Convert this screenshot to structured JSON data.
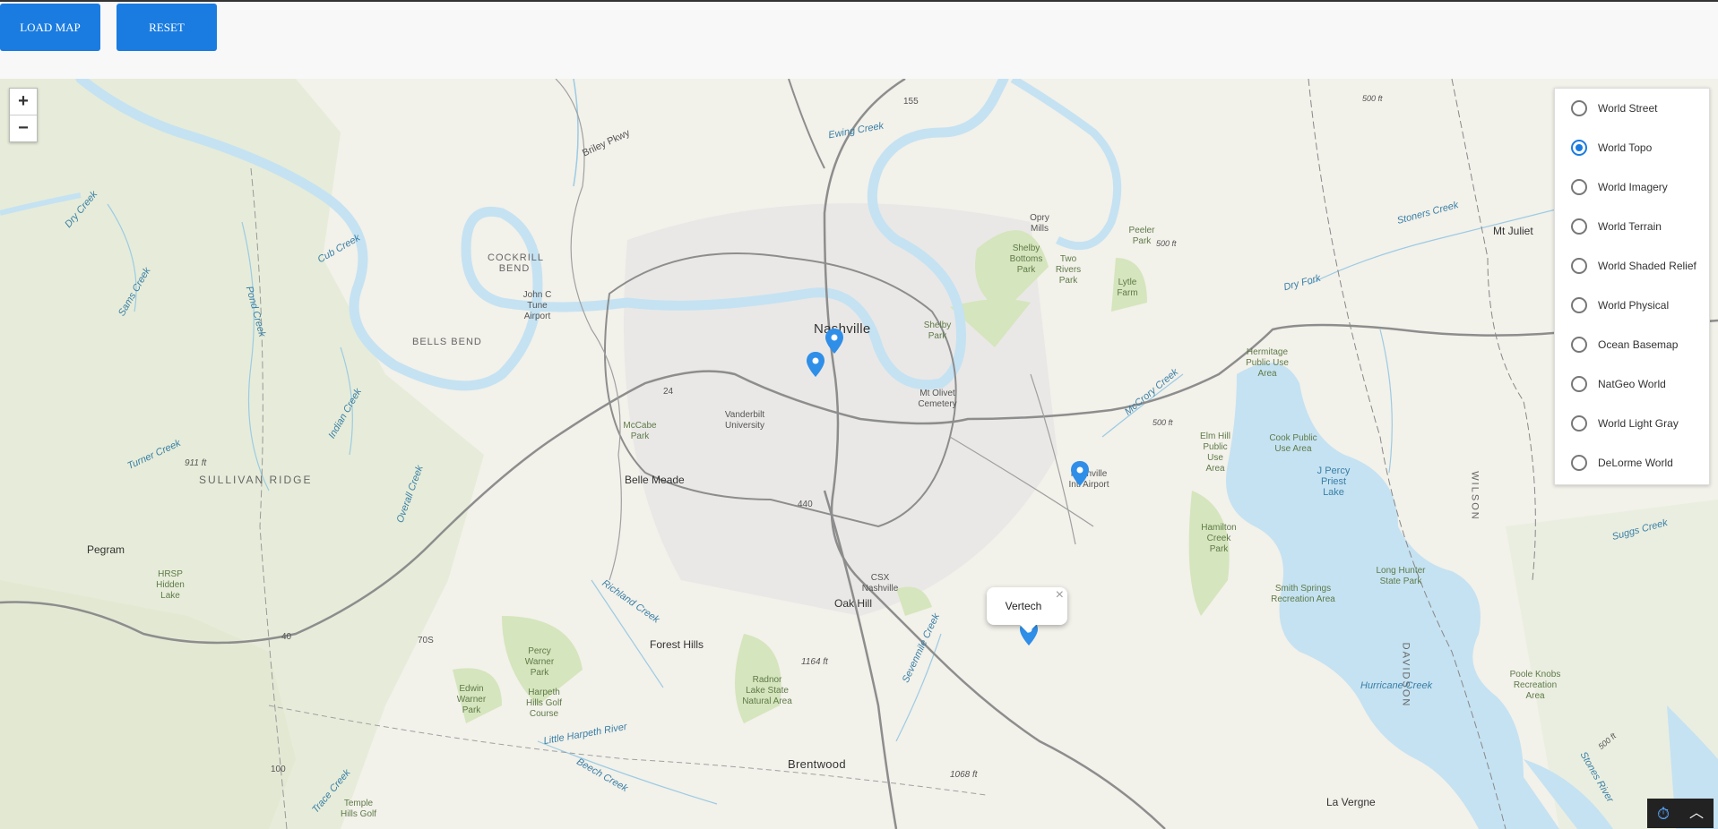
{
  "toolbar": {
    "load_label": "LOAD MAP",
    "reset_label": "RESET"
  },
  "zoom": {
    "in_label": "+",
    "out_label": "−"
  },
  "basemaps": {
    "options": [
      "World Street",
      "World Topo",
      "World Imagery",
      "World Terrain",
      "World Shaded Relief",
      "World Physical",
      "Ocean Basemap",
      "NatGeo World",
      "World Light Gray",
      "DeLorme World"
    ],
    "selected": "World Topo"
  },
  "popup": {
    "title": "Vertech",
    "close_label": "×"
  },
  "map_labels": {
    "nashville": "Nashville",
    "belle_meade": "Belle Meade",
    "oak_hill": "Oak Hill",
    "forest_hills": "Forest Hills",
    "brentwood": "Brentwood",
    "la_vergne": "La Vergne",
    "pegram": "Pegram",
    "mt_juliet": "Mt Juliet",
    "bells_bend": "BELLS BEND",
    "cockrill_bend": "COCKRILL BEND",
    "sullivan_ridge": "SULLIVAN RIDGE",
    "davidson": "DAVIDSON",
    "wilson": "WILSON",
    "john_tune": "John C Tune Airport",
    "intl_airport": "Nashville Intl Airport",
    "vanderbilt": "Vanderbilt University",
    "mccabe": "McCabe Park",
    "shelby_park": "Shelby Park",
    "shelby_bottoms": "Shelby Bottoms Park",
    "two_rivers": "Two Rivers Park",
    "opry_mills": "Opry Mills",
    "mt_olivet": "Mt Olivet Cemetery",
    "csx": "CSX Nashville",
    "percy_warner": "Percy Warner Park",
    "edwin_warner": "Edwin Warner Park",
    "harpeth_hills": "Harpeth Hills Golf Course",
    "radnor": "Radnor Lake State Natural Area",
    "hrsp": "HRSP Hidden Lake",
    "temple_hills": "Temple Hills Golf",
    "peeler": "Peeler Park",
    "lytle": "Lytle Farm",
    "hermitage": "Hermitage Public Use Area",
    "elm_hill": "Elm Hill Public Use Area",
    "cook_public": "Cook Public Use Area",
    "j_percy": "J Percy Priest Lake",
    "hamilton_creek": "Hamilton Creek Park",
    "smith_springs": "Smith Springs Recreation Area",
    "long_hunter": "Long Hunter State Park",
    "poole_knobs": "Poole Knobs Recreation Area",
    "ewing_creek": "Ewing Creek",
    "dry_creek": "Dry Creek",
    "cub_creek": "Cub Creek",
    "sams_creek": "Sams Creek",
    "pond_creek": "Pond Creek",
    "indian_creek": "Indian Creek",
    "turner_creek": "Turner Creek",
    "overall_creek": "Overall Creek",
    "richland_creek": "Richland Creek",
    "sevenmile_creek": "Sevenmile Creek",
    "little_harpeth": "Little Harpeth River",
    "beech_creek": "Beech Creek",
    "trace_creek": "Trace Creek",
    "mccrory_creek": "McCrory Creek",
    "dry_fork": "Dry Fork",
    "stoners_creek": "Stoners Creek",
    "sugg_creek": "Suggs Creek",
    "hurricane_creek": "Hurricane Creek",
    "stones_river": "Stones River",
    "briley": "Briley Pkwy",
    "r155": "155",
    "r24": "24",
    "r440": "440",
    "r40": "40",
    "r70s": "70S",
    "r100": "100",
    "e911": "911 ft",
    "e1164": "1164 ft",
    "e1068": "1068 ft",
    "e500a": "500 ft",
    "e500b": "500 ft",
    "e500c": "500 ft",
    "e500d": "500 ft"
  },
  "colors": {
    "accent": "#1a7ce0",
    "water": "#c5e2f2",
    "land": "#f2f1ea",
    "park": "#d7e6c0",
    "road": "#8d8d8d"
  },
  "corner_icons": [
    "clock-icon",
    "chevron-up-icon"
  ]
}
